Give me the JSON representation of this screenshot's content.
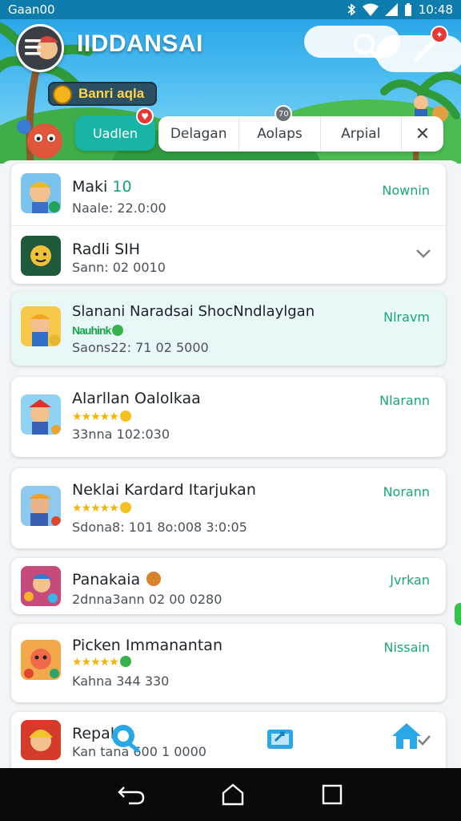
{
  "status_bar": {
    "carrier": "Gaan00",
    "time": "10:48"
  },
  "header": {
    "title": "IIDDANSAI",
    "banner": "Banri aqla"
  },
  "tabs": {
    "active": "Uadlen",
    "items": [
      "Delagan",
      "Aolaps",
      "Arpial"
    ],
    "close": "✕",
    "badge_text": "70"
  },
  "apps": [
    {
      "name": "Maki",
      "name_accent": "10",
      "sub": "Naale: 22.0:00",
      "action": "Nownin"
    },
    {
      "name": "Radli SIH",
      "sub": "Sann: 02 0010",
      "action": ""
    },
    {
      "name": "Slanani Naradsai ShocNndlaylgan",
      "rating_text": "Nauhink",
      "sub": "Saons22: 71 02 5000",
      "action": "Nlravm"
    },
    {
      "name": "Alarllan Oalolkaa",
      "sub": "33nna 102:030",
      "action": "Nlarann"
    },
    {
      "name": "Neklai Kardard Itarjukan",
      "sub": "Sdona8: 101 8o:008  3:0:05",
      "action": "Norann"
    },
    {
      "name": "Panakaia",
      "sub": "2dnna3ann 02 00 0280",
      "action": "Jvrkan"
    },
    {
      "name": "Picken Immanantan",
      "sub": "Kahna 344 330",
      "action": "Nissain"
    },
    {
      "name": "Repal",
      "sub": "Kan  tana 600   1 0000",
      "action": ""
    }
  ],
  "colors": {
    "accent": "#18b5a6",
    "action_green": "#1aa57a",
    "status_bar": "#0f7cae"
  }
}
